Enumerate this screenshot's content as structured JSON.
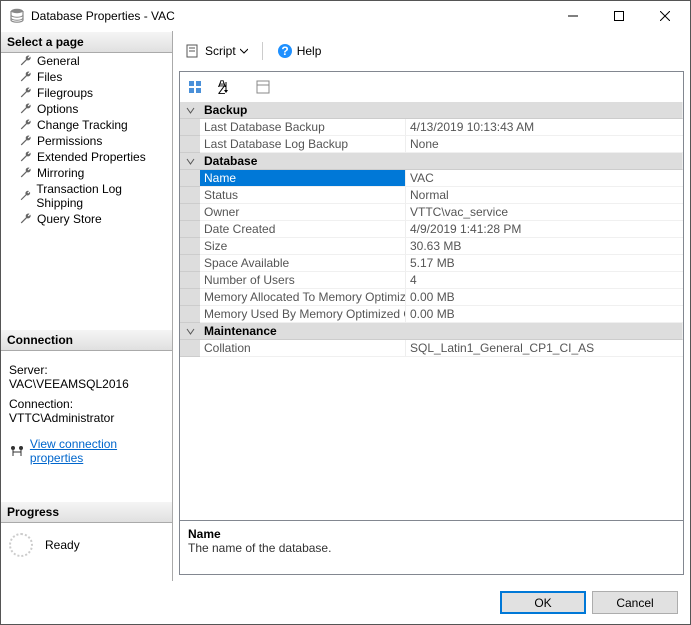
{
  "window": {
    "title": "Database Properties - VAC"
  },
  "toolbar": {
    "script": "Script",
    "help": "Help"
  },
  "left": {
    "select_page": "Select a page",
    "pages": [
      "General",
      "Files",
      "Filegroups",
      "Options",
      "Change Tracking",
      "Permissions",
      "Extended Properties",
      "Mirroring",
      "Transaction Log Shipping",
      "Query Store"
    ],
    "connection_header": "Connection",
    "server_label": "Server:",
    "server_value": "VAC\\VEEAMSQL2016",
    "connection_label": "Connection:",
    "connection_value": "VTTC\\Administrator",
    "view_conn": "View connection properties",
    "progress_header": "Progress",
    "progress_status": "Ready"
  },
  "grid": {
    "cat_backup": "Backup",
    "backup": [
      {
        "k": "Last Database Backup",
        "v": "4/13/2019 10:13:43 AM"
      },
      {
        "k": "Last Database Log Backup",
        "v": "None"
      }
    ],
    "cat_database": "Database",
    "database": [
      {
        "k": "Name",
        "v": "VAC",
        "sel": true
      },
      {
        "k": "Status",
        "v": "Normal"
      },
      {
        "k": "Owner",
        "v": "VTTC\\vac_service"
      },
      {
        "k": "Date Created",
        "v": "4/9/2019 1:41:28 PM"
      },
      {
        "k": "Size",
        "v": "30.63 MB"
      },
      {
        "k": "Space Available",
        "v": "5.17 MB"
      },
      {
        "k": "Number of Users",
        "v": "4"
      },
      {
        "k": "Memory Allocated To Memory Optimized Objects",
        "v": "0.00 MB"
      },
      {
        "k": "Memory Used By Memory Optimized Objects",
        "v": "0.00 MB"
      }
    ],
    "cat_maintenance": "Maintenance",
    "maintenance": [
      {
        "k": "Collation",
        "v": "SQL_Latin1_General_CP1_CI_AS"
      }
    ]
  },
  "desc": {
    "title": "Name",
    "text": "The name of the database."
  },
  "footer": {
    "ok": "OK",
    "cancel": "Cancel"
  }
}
